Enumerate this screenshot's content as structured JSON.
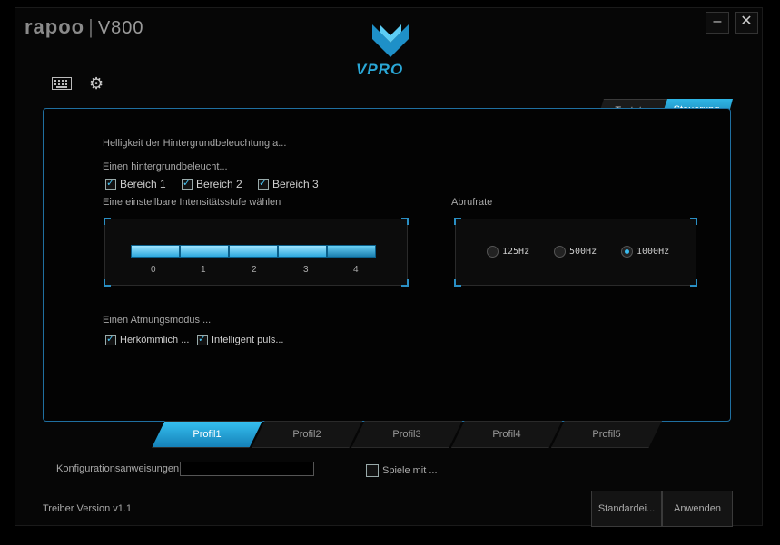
{
  "app": {
    "brand": "rapoo",
    "model": "V800",
    "logo_text": "VPRO"
  },
  "window": {
    "minimize": "–",
    "close": "✕"
  },
  "toolbar": {
    "keyboard_icon": "keyboard-icon",
    "settings_icon": "gear-icon"
  },
  "tabs": [
    {
      "label": "Tastatur",
      "active": false
    },
    {
      "label": "Steuerung",
      "active": true
    }
  ],
  "backlight": {
    "heading": "Helligkeit der Hintergrundbeleuchtung a...",
    "area_label": "Einen hintergrundbeleucht...",
    "areas": [
      {
        "label": "Bereich 1",
        "checked": true
      },
      {
        "label": "Bereich 2",
        "checked": true
      },
      {
        "label": "Bereich 3",
        "checked": true
      }
    ],
    "intensity_label": "Eine einstellbare Intensitätsstufe wählen",
    "ticks": [
      "0",
      "1",
      "2",
      "3",
      "4"
    ]
  },
  "polling": {
    "label": "Abrufrate",
    "options": [
      {
        "label": "125Hz",
        "selected": false
      },
      {
        "label": "500Hz",
        "selected": false
      },
      {
        "label": "1000Hz",
        "selected": true
      }
    ]
  },
  "breathing": {
    "label": "Einen Atmungsmodus ...",
    "options": [
      {
        "label": "Herkömmlich ...",
        "checked": true
      },
      {
        "label": "Intelligent puls...",
        "checked": true
      }
    ]
  },
  "profiles": [
    {
      "label": "Profil1",
      "active": true
    },
    {
      "label": "Profil2"
    },
    {
      "label": "Profil3"
    },
    {
      "label": "Profil4"
    },
    {
      "label": "Profil5"
    }
  ],
  "config": {
    "label": "Konfigurationsanweisungen:",
    "value": ""
  },
  "games": {
    "label": "Spiele mit ...",
    "checked": false
  },
  "footer": {
    "version": "Treiber Version v1.1",
    "default_button": "Standardei...",
    "apply_button": "Anwenden"
  },
  "colors": {
    "accent": "#2aa7d6",
    "background": "#060606"
  }
}
